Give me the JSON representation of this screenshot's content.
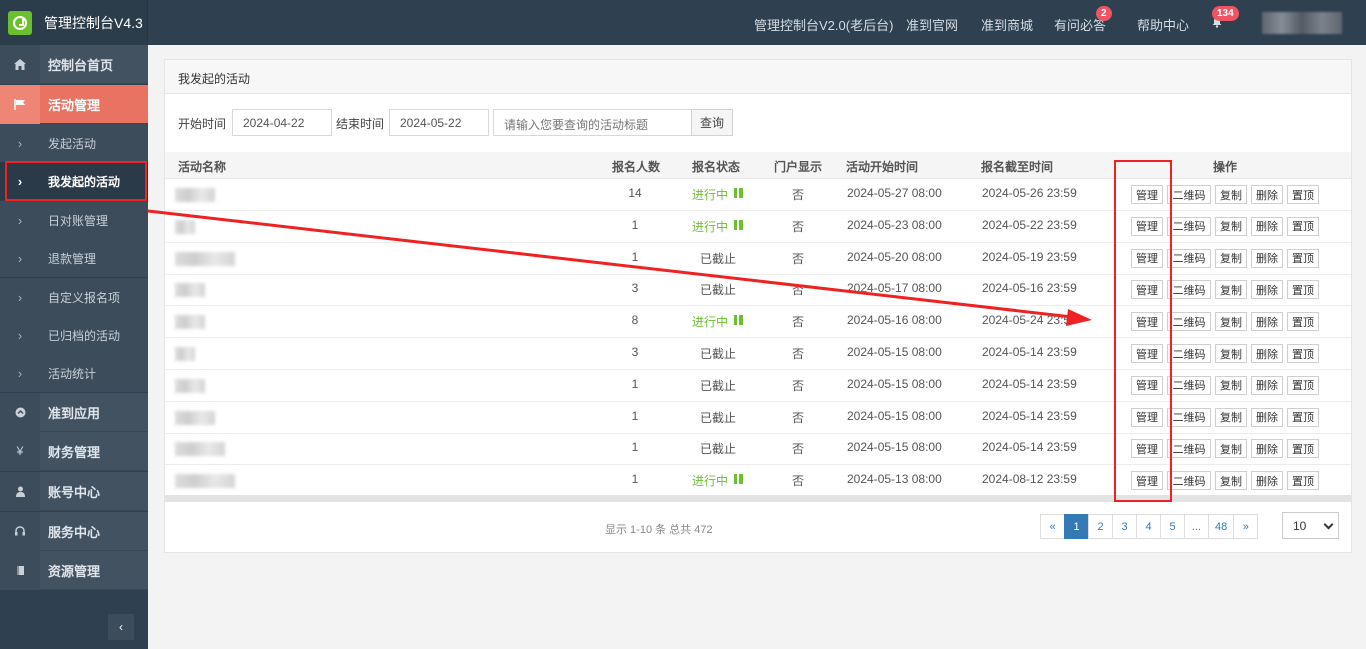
{
  "app": {
    "title": "管理控制台V4.3",
    "nav": [
      {
        "label": "管理控制台V2.0(老后台)"
      },
      {
        "label": "准到官网"
      },
      {
        "label": "准到商城"
      },
      {
        "label": "有问必答",
        "badge": "2"
      },
      {
        "label": "帮助中心"
      }
    ],
    "notify_badge": "134"
  },
  "sidebar": {
    "items": [
      {
        "label": "控制台首页",
        "icon": "home-icon"
      },
      {
        "label": "活动管理",
        "icon": "flag-icon"
      },
      {
        "label": "准到应用",
        "icon": "app-icon"
      },
      {
        "label": "财务管理",
        "icon": "yen-icon"
      },
      {
        "label": "账号中心",
        "icon": "user-icon"
      },
      {
        "label": "服务中心",
        "icon": "headset-icon"
      },
      {
        "label": "资源管理",
        "icon": "book-icon"
      }
    ],
    "sub": [
      {
        "label": "发起活动"
      },
      {
        "label": "我发起的活动"
      },
      {
        "label": "日对账管理"
      },
      {
        "label": "退款管理"
      },
      {
        "label": "自定义报名项"
      },
      {
        "label": "已归档的活动"
      },
      {
        "label": "活动统计"
      }
    ],
    "chevron": "›",
    "collapse": "‹"
  },
  "panel": {
    "title": "我发起的活动"
  },
  "filter": {
    "start_label": "开始时间",
    "start_value": "2024-04-22",
    "end_label": "结束时间",
    "end_value": "2024-05-22",
    "search_placeholder": "请输入您要查询的活动标题",
    "search_button": "查询"
  },
  "table": {
    "headers": [
      "活动名称",
      "报名人数",
      "报名状态",
      "门户显示",
      "活动开始时间",
      "报名截至时间",
      "操作"
    ],
    "actions": [
      "管理",
      "二维码",
      "复制",
      "删除",
      "置顶"
    ],
    "rows": [
      {
        "count": "14",
        "status": "进行中",
        "active": true,
        "portal": "否",
        "start": "2024-05-27 08:00",
        "deadline": "2024-05-26 23:59"
      },
      {
        "count": "1",
        "status": "进行中",
        "active": true,
        "portal": "否",
        "start": "2024-05-23 08:00",
        "deadline": "2024-05-22 23:59"
      },
      {
        "count": "1",
        "status": "已截止",
        "active": false,
        "portal": "否",
        "start": "2024-05-20 08:00",
        "deadline": "2024-05-19 23:59"
      },
      {
        "count": "3",
        "status": "已截止",
        "active": false,
        "portal": "否",
        "start": "2024-05-17 08:00",
        "deadline": "2024-05-16 23:59"
      },
      {
        "count": "8",
        "status": "进行中",
        "active": true,
        "portal": "否",
        "start": "2024-05-16 08:00",
        "deadline": "2024-05-24 23:59"
      },
      {
        "count": "3",
        "status": "已截止",
        "active": false,
        "portal": "否",
        "start": "2024-05-15 08:00",
        "deadline": "2024-05-14 23:59"
      },
      {
        "count": "1",
        "status": "已截止",
        "active": false,
        "portal": "否",
        "start": "2024-05-15 08:00",
        "deadline": "2024-05-14 23:59"
      },
      {
        "count": "1",
        "status": "已截止",
        "active": false,
        "portal": "否",
        "start": "2024-05-15 08:00",
        "deadline": "2024-05-14 23:59"
      },
      {
        "count": "1",
        "status": "已截止",
        "active": false,
        "portal": "否",
        "start": "2024-05-15 08:00",
        "deadline": "2024-05-14 23:59"
      },
      {
        "count": "1",
        "status": "进行中",
        "active": true,
        "portal": "否",
        "start": "2024-05-13 08:00",
        "deadline": "2024-08-12 23:59"
      }
    ]
  },
  "pagination": {
    "summary": "显示 1-10 条 总共 472",
    "pages": [
      "«",
      "1",
      "2",
      "3",
      "4",
      "5",
      "...",
      "48",
      "»"
    ],
    "current": "1",
    "page_size": "10"
  },
  "colors": {
    "topbar": "#2f4050",
    "accent": "#e87363",
    "status_on": "#6cbf2f",
    "link": "#337ab7",
    "annotation": "#ee2222"
  }
}
